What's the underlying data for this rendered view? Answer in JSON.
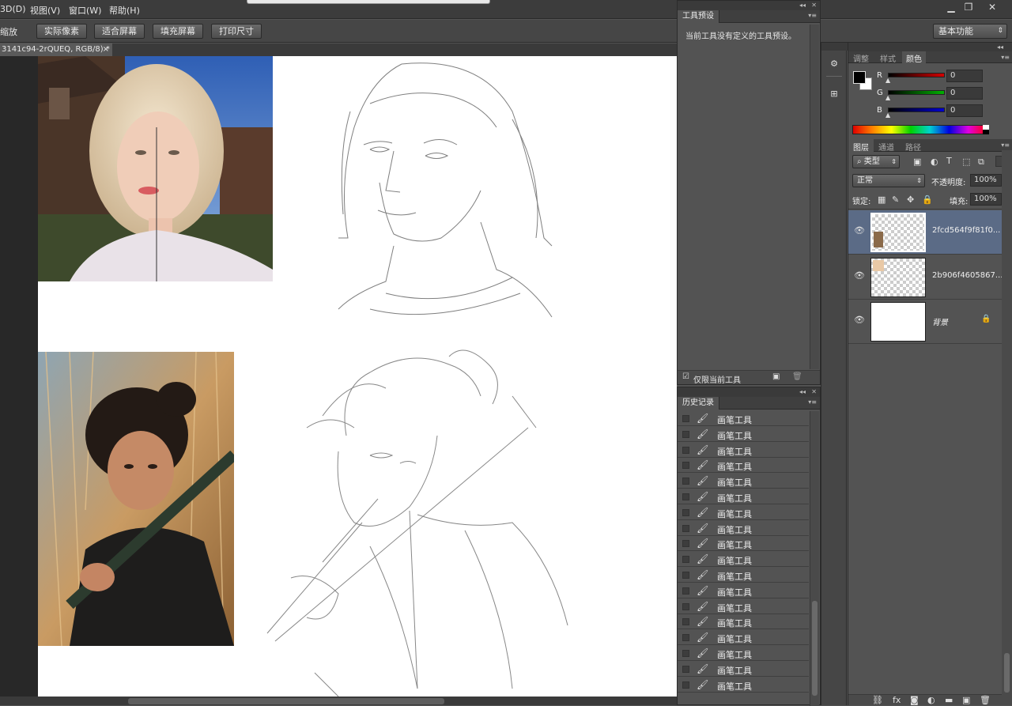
{
  "menu": [
    "3D(D)",
    "视图(V)",
    "窗口(W)",
    "帮助(H)"
  ],
  "options": {
    "zoom_label": "缩放",
    "buttons": [
      "实际像素",
      "适合屏幕",
      "填充屏幕",
      "打印尺寸"
    ],
    "workspace": "基本功能"
  },
  "document": {
    "tab": "3141c94-2rQUEQ, RGB/8) *",
    "close": "×"
  },
  "tool_presets": {
    "title": "工具预设",
    "empty_message": "当前工具没有定义的工具预设。",
    "current_only": "仅限当前工具"
  },
  "history": {
    "title": "历史记录",
    "items": [
      "画笔工具",
      "画笔工具",
      "画笔工具",
      "画笔工具",
      "画笔工具",
      "画笔工具",
      "画笔工具",
      "画笔工具",
      "画笔工具",
      "画笔工具",
      "画笔工具",
      "画笔工具",
      "画笔工具",
      "画笔工具",
      "画笔工具",
      "画笔工具",
      "画笔工具",
      "画笔工具"
    ]
  },
  "color_panel": {
    "tabs": [
      "调整",
      "样式",
      "颜色"
    ],
    "channels": [
      {
        "label": "R",
        "value": "0",
        "gradient": "#d40000"
      },
      {
        "label": "G",
        "value": "0",
        "gradient": "#00b000"
      },
      {
        "label": "B",
        "value": "0",
        "gradient": "#0000d0"
      }
    ]
  },
  "layers_panel": {
    "tabs": [
      "图层",
      "通道",
      "路径"
    ],
    "filter": "类型",
    "blend_mode": "正常",
    "opacity_label": "不透明度:",
    "opacity": "100%",
    "lock_label": "锁定:",
    "fill_label": "填充:",
    "fill": "100%",
    "layers": [
      {
        "name": "2fcd564f9f81f0...",
        "selected": true
      },
      {
        "name": "2b906f4605867...",
        "selected": false
      },
      {
        "name": "背景",
        "selected": false,
        "locked": true
      }
    ]
  },
  "colors": {
    "accent_selected": "#5b6b86",
    "panel": "#535353"
  }
}
